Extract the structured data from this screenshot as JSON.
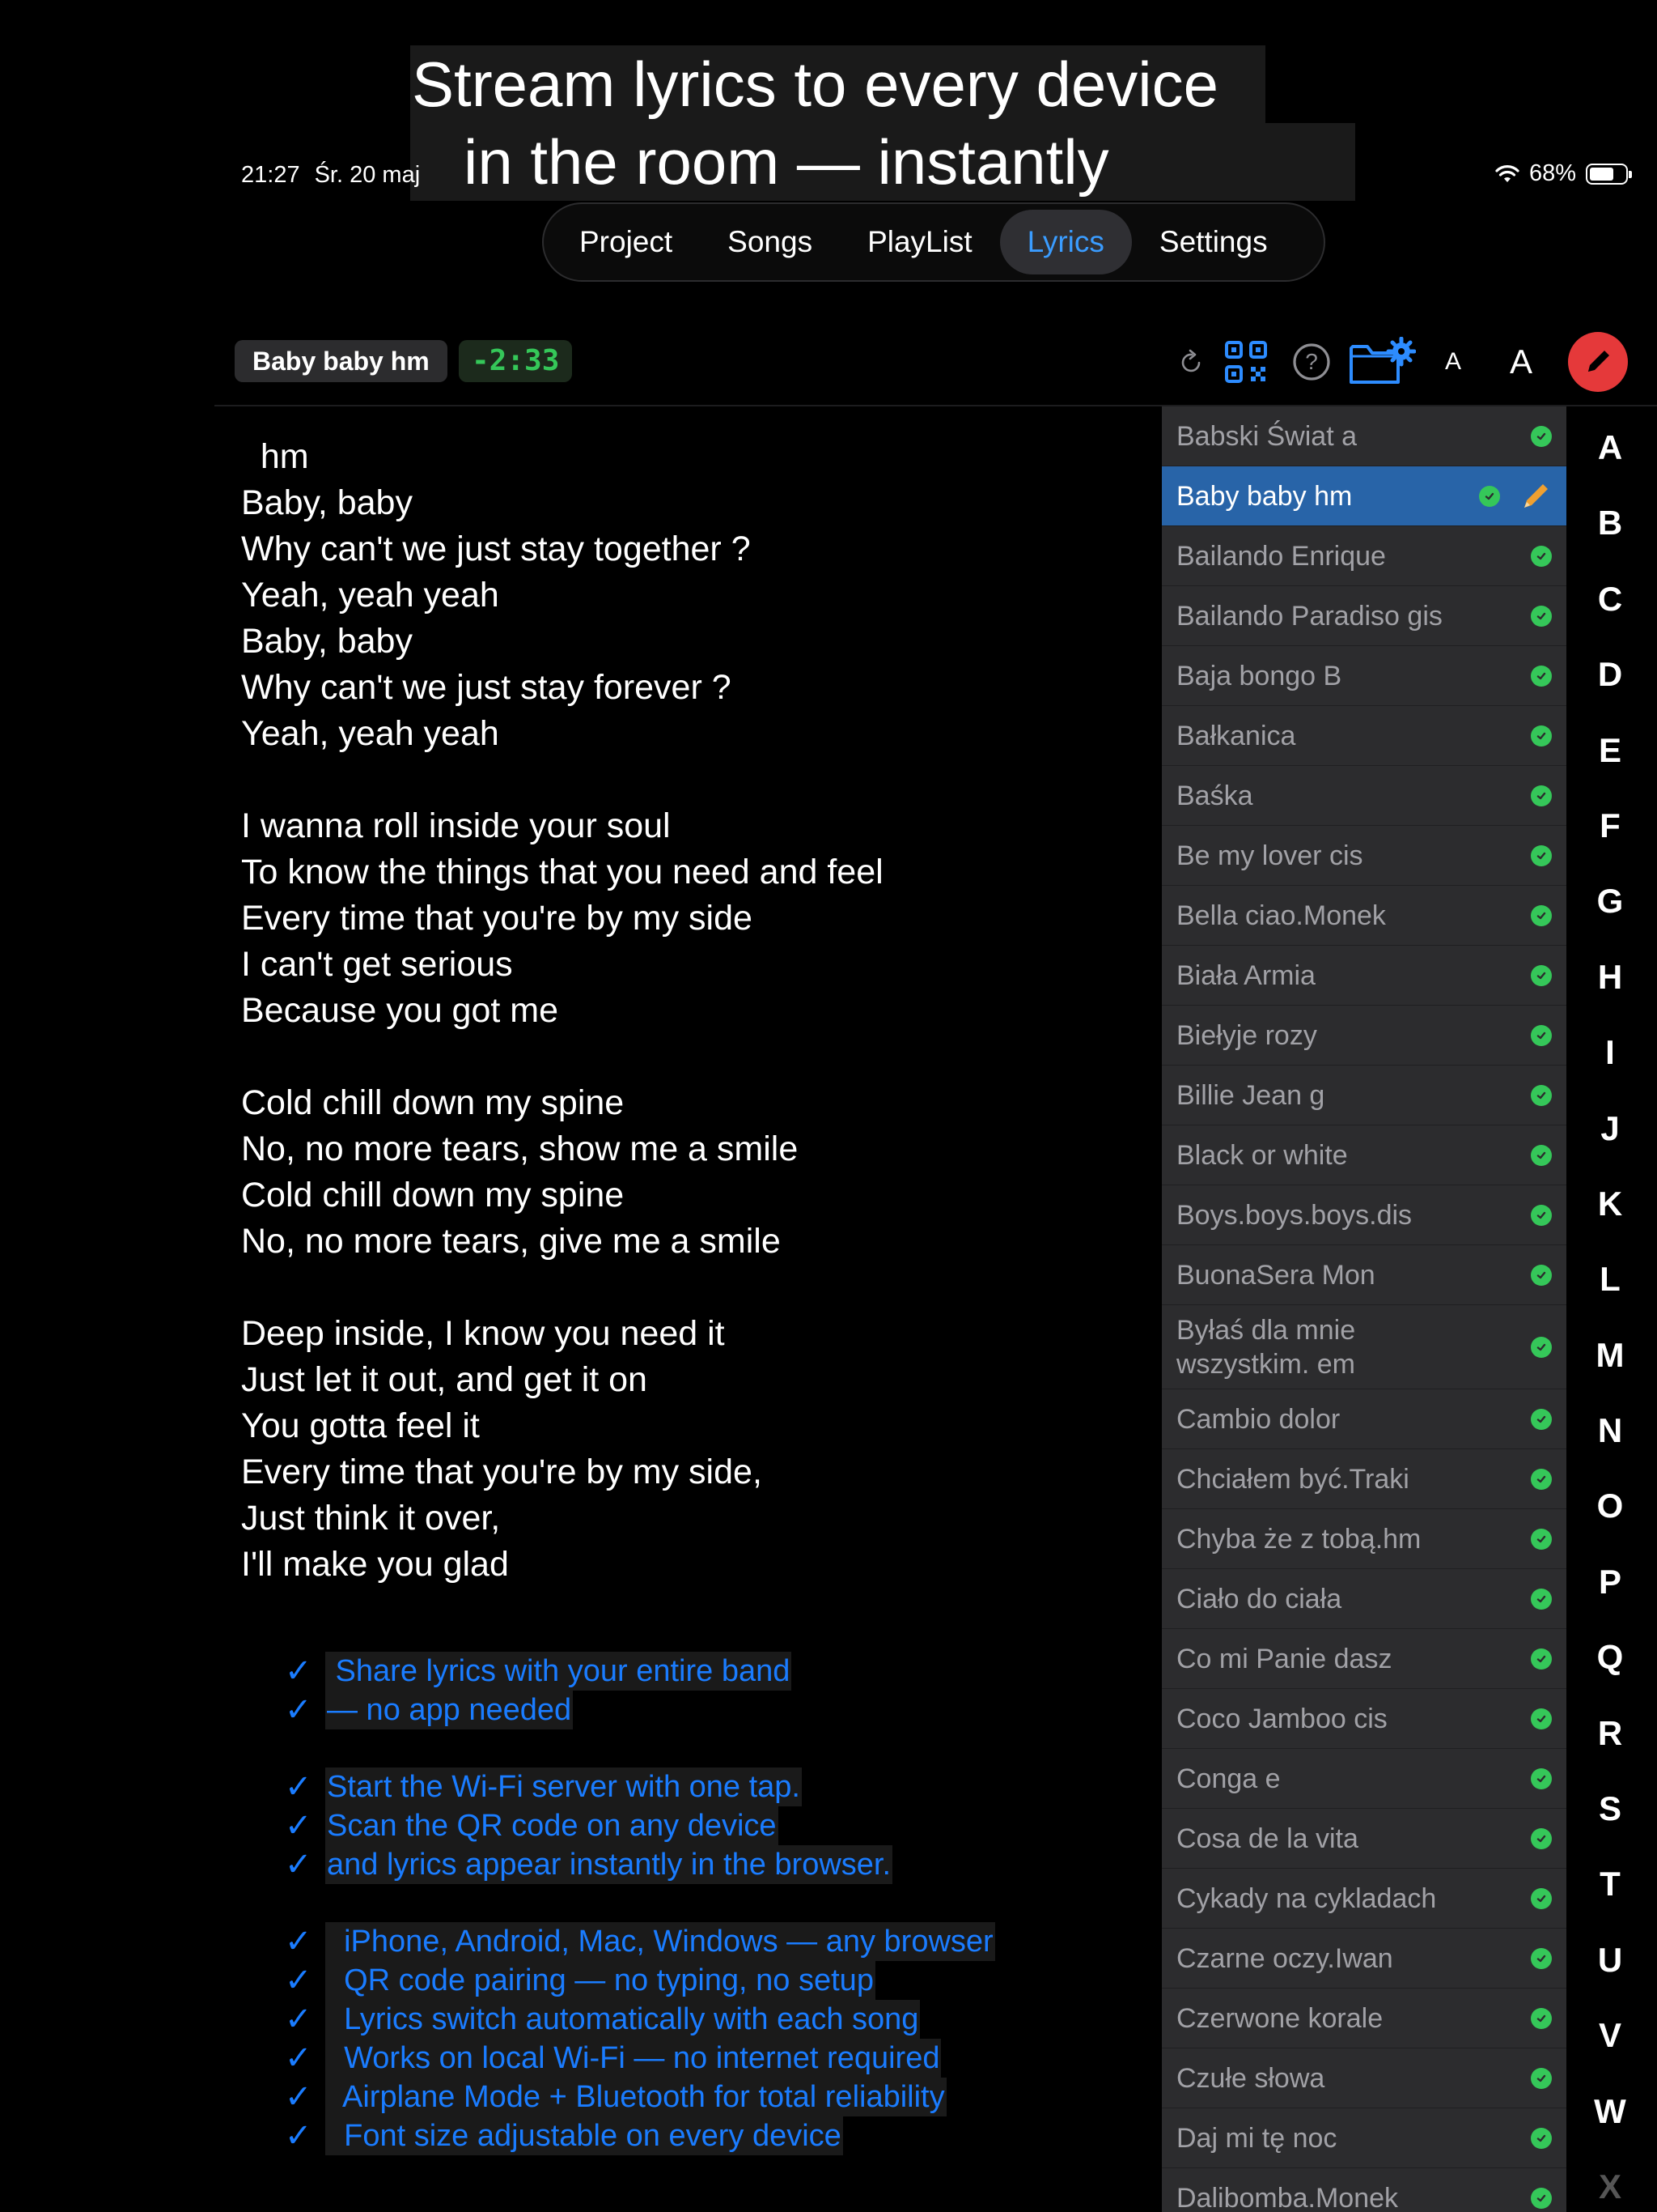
{
  "promo": {
    "headline_line1": "Stream lyrics to every device",
    "headline_line2": "in the room — instantly"
  },
  "status": {
    "time": "21:27",
    "date": "Śr. 20 maj",
    "battery": "68%",
    "battery_level": 0.68
  },
  "tabs": [
    "Project",
    "Songs",
    "PlayList",
    "Lyrics",
    "Settings"
  ],
  "active_tab": "Lyrics",
  "toolbar": {
    "song_title": "Baby baby hm",
    "time_remaining": "-2:33",
    "small_a": "A",
    "large_a": "A",
    "icons": [
      "refresh-icon",
      "qr-code-icon",
      "help-icon",
      "folder-settings-icon",
      "font-smaller-icon",
      "font-larger-icon",
      "pencil-icon"
    ]
  },
  "lyrics": "  hm\nBaby, baby\nWhy can't we just stay together ?\nYeah, yeah yeah\nBaby, baby\nWhy can't we just stay forever ?\nYeah, yeah yeah\n\nI wanna roll inside your soul\nTo know the things that you need and feel\nEvery time that you're by my side\nI can't get serious\nBecause you got me\n\nCold chill down my spine\nNo, no more tears, show me a smile\nCold chill down my spine\nNo, no more tears, give me a smile\n\nDeep inside, I know you need it\nJust let it out, and get it on\nYou gotta feel it\nEvery time that you're by my side,\nJust think it over,\nI'll make you glad",
  "features": [
    [
      " Share lyrics with your entire band",
      "— no app needed"
    ],
    [
      "Start the Wi-Fi server with one tap.",
      "Scan the QR code on any device",
      "and lyrics appear instantly in the browser."
    ],
    [
      "  iPhone, Android, Mac, Windows — any browser",
      "  QR code pairing — no typing, no setup",
      "  Lyrics switch automatically with each song",
      "  Works on local Wi-Fi — no internet required",
      "  Airplane Mode + Bluetooth for total reliability",
      "  Font size adjustable on every device"
    ]
  ],
  "check_mark": "✓",
  "songs": [
    "Babski Świat a",
    "Baby baby hm",
    "Bailando Enrique",
    "Bailando Paradiso gis",
    "Baja bongo B",
    "Bałkanica",
    "Baśka",
    "Be my lover cis",
    "Bella ciao.Monek",
    "Biała Armia",
    "Biełyje rozy",
    "Billie Jean g",
    "Black or white",
    "Boys.boys.boys.dis",
    "BuonaSera Mon",
    "Byłaś dla mnie\nwszystkim. em",
    "Cambio dolor",
    "Chciałem być.Traki",
    "Chyba że z tobą.hm",
    "Ciało do ciała",
    "Co mi Panie dasz",
    "Coco Jamboo cis",
    "Conga e",
    "Cosa de la vita",
    "Cykady na cykladach",
    "Czarne oczy.Iwan",
    "Czerwone korale",
    "Czułe słowa",
    "Daj mi tę noc",
    "Dalibomba.Monek"
  ],
  "selected_song": "Baby baby hm",
  "alphabet": [
    "A",
    "B",
    "C",
    "D",
    "E",
    "F",
    "G",
    "H",
    "I",
    "J",
    "K",
    "L",
    "M",
    "N",
    "O",
    "P",
    "Q",
    "R",
    "S",
    "T",
    "U",
    "V",
    "W",
    "X"
  ],
  "colors": {
    "accent_blue": "#3a9cff",
    "promo_blue": "#1a7cff",
    "timer_green": "#35c759",
    "edit_red": "#e5393a",
    "selected_row": "#2864a8"
  }
}
